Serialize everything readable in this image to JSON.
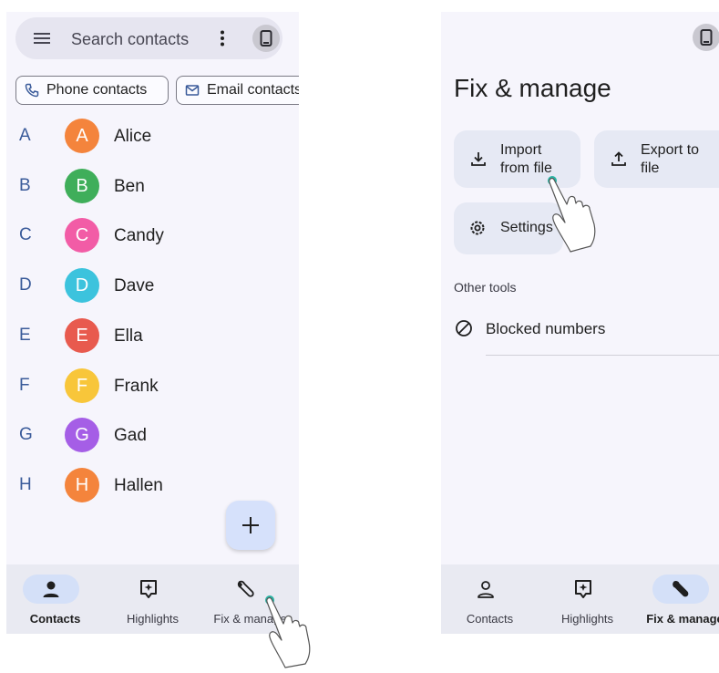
{
  "left_screen": {
    "search": {
      "placeholder": "Search contacts"
    },
    "chips": [
      {
        "label": "Phone contacts",
        "icon": "phone-icon"
      },
      {
        "label": "Email contacts",
        "icon": "mail-icon"
      }
    ],
    "contacts": [
      {
        "letter": "A",
        "initial": "A",
        "name": "Alice",
        "color": "#f4843c"
      },
      {
        "letter": "B",
        "initial": "B",
        "name": "Ben",
        "color": "#3fae5a"
      },
      {
        "letter": "C",
        "initial": "C",
        "name": "Candy",
        "color": "#f25ca6"
      },
      {
        "letter": "D",
        "initial": "D",
        "name": "Dave",
        "color": "#3cc3dd"
      },
      {
        "letter": "E",
        "initial": "E",
        "name": "Ella",
        "color": "#e85a4e"
      },
      {
        "letter": "F",
        "initial": "F",
        "name": "Frank",
        "color": "#f8c63a"
      },
      {
        "letter": "G",
        "initial": "G",
        "name": "Gad",
        "color": "#a55ee6"
      },
      {
        "letter": "H",
        "initial": "H",
        "name": "Hallen",
        "color": "#f4843c"
      }
    ],
    "fab_icon": "add-icon",
    "nav": [
      {
        "label": "Contacts",
        "icon": "person-icon",
        "active": true
      },
      {
        "label": "Highlights",
        "icon": "highlights-icon",
        "active": false
      },
      {
        "label": "Fix & manage",
        "icon": "wrench-icon",
        "active": false
      }
    ]
  },
  "right_screen": {
    "title": "Fix & manage",
    "tiles": [
      {
        "line1": "Import",
        "line2": "from file",
        "icon": "download-icon"
      },
      {
        "line1": "Export to",
        "line2": "file",
        "icon": "upload-icon"
      },
      {
        "label": "Settings",
        "icon": "settings-icon"
      }
    ],
    "section_label": "Other tools",
    "blocked_label": "Blocked numbers",
    "nav": [
      {
        "label": "Contacts",
        "icon": "person-outline-icon",
        "active": false
      },
      {
        "label": "Highlights",
        "icon": "highlights-icon",
        "active": false
      },
      {
        "label": "Fix & manage",
        "icon": "wrench-icon",
        "active": true
      }
    ]
  },
  "colors": {
    "accent_pill": "#d4e0f8",
    "letter_blue": "#3a5b9a",
    "touch_dot": "#2bb3a3"
  }
}
